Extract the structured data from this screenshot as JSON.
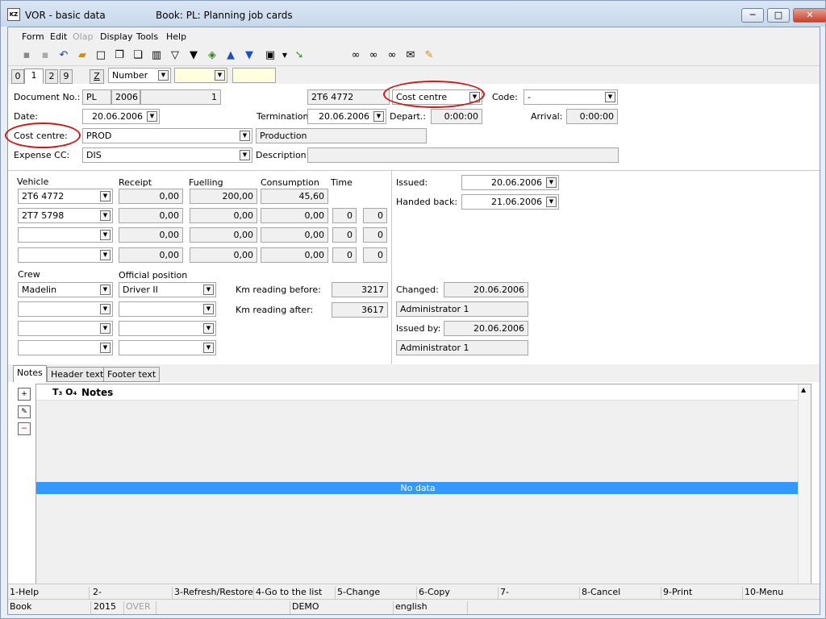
{
  "window": {
    "app_title": "VOR - basic data",
    "book_title": "Book: PL: Planning job cards",
    "minimize": "─",
    "maximize": "□",
    "close": "✕",
    "app_icon": "KZ"
  },
  "menu": [
    "Form",
    "Edit",
    "Olap",
    "Display",
    "Tools",
    "Help"
  ],
  "toolbar": {
    "filter_combo": "Number"
  },
  "page_tabs": [
    "0",
    "1",
    "2",
    "9"
  ],
  "z_button": "Z",
  "header": {
    "doc_no_label": "Document No.:",
    "doc_prefix": "PL",
    "doc_year": "2006",
    "doc_number": "1",
    "vehicle_top": "2T6 4772",
    "cost_centre_combo": "Cost centre",
    "code_label": "Code:",
    "code_value": "-",
    "date_label": "Date:",
    "date_value": "20.06.2006",
    "termination_label": "Termination:",
    "termination_value": "20.06.2006",
    "depart_label": "Depart.:",
    "depart_value": "0:00:00",
    "arrival_label": "Arrival:",
    "arrival_value": "0:00:00",
    "cost_centre_label": "Cost centre:",
    "cost_centre_value": "PROD",
    "cost_centre_desc": "Production",
    "expense_cc_label": "Expense CC:",
    "expense_cc_value": "DIS",
    "description_label": "Description:",
    "description_value": ""
  },
  "vehicles": {
    "headers": {
      "vehicle": "Vehicle",
      "receipt": "Receipt",
      "fuelling": "Fuelling",
      "consumption": "Consumption",
      "time": "Time"
    },
    "rows": [
      {
        "vehicle": "2T6 4772",
        "receipt": "0,00",
        "fuelling": "200,00",
        "consumption": "45,60",
        "t1": "",
        "t2": ""
      },
      {
        "vehicle": "2T7 5798",
        "receipt": "0,00",
        "fuelling": "0,00",
        "consumption": "0,00",
        "t1": "0",
        "t2": "0"
      },
      {
        "vehicle": "",
        "receipt": "0,00",
        "fuelling": "0,00",
        "consumption": "0,00",
        "t1": "0",
        "t2": "0"
      },
      {
        "vehicle": "",
        "receipt": "0,00",
        "fuelling": "0,00",
        "consumption": "0,00",
        "t1": "0",
        "t2": "0"
      }
    ]
  },
  "issue": {
    "issued_label": "Issued:",
    "issued_value": "20.06.2006",
    "handed_label": "Handed back:",
    "handed_value": "21.06.2006"
  },
  "crew": {
    "crew_label": "Crew",
    "position_label": "Official position",
    "rows": [
      {
        "crew": "Madelin",
        "position": "Driver II"
      },
      {
        "crew": "",
        "position": ""
      },
      {
        "crew": "",
        "position": ""
      },
      {
        "crew": "",
        "position": ""
      }
    ]
  },
  "km": {
    "before_label": "Km reading before:",
    "before_value": "3217",
    "after_label": "Km reading after:",
    "after_value": "3617"
  },
  "audit": {
    "changed_label": "Changed:",
    "changed_value": "20.06.2006",
    "changed_by": "Administrator 1",
    "issued_by_label": "Issued by:",
    "issued_by_value": "20.06.2006",
    "issued_by_user": "Administrator 1"
  },
  "subtabs": [
    "Notes",
    "Header text",
    "Footer text"
  ],
  "notes": {
    "title": "Notes",
    "font_icons": "T₃ O₄",
    "empty": "No data"
  },
  "fkeys": [
    "1-Help",
    "2-",
    "3-Refresh/Restore",
    "4-Go to the list",
    "5-Change",
    "6-Copy",
    "7-",
    "8-Cancel",
    "9-Print",
    "10-Menu"
  ],
  "status": [
    "Book",
    "2015",
    "OVER",
    "",
    "DEMO",
    "english",
    ""
  ]
}
